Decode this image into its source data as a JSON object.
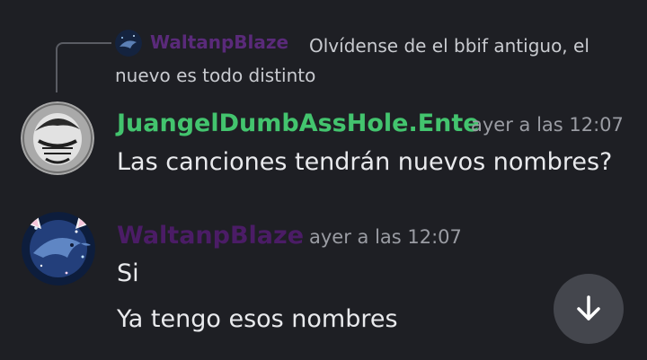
{
  "reply": {
    "author": "WaltanpBlaze",
    "author_color": "#5a2a7a",
    "text": "Olvídense de el bbif antiguo, el nuevo es todo distinto"
  },
  "messages": [
    {
      "author": "JuangelDumbAssHole.Ente",
      "author_color": "#43c46e",
      "timestamp": "ayer a las 12:07",
      "lines": [
        "Las canciones tendrán nuevos nombres?"
      ]
    },
    {
      "author": "WaltanpBlaze",
      "author_color": "#4b1c66",
      "timestamp": "ayer a las 12:07",
      "lines": [
        "Si",
        "Ya tengo esos nombres"
      ]
    }
  ],
  "scroll_button": {
    "icon": "arrow-down-icon"
  }
}
